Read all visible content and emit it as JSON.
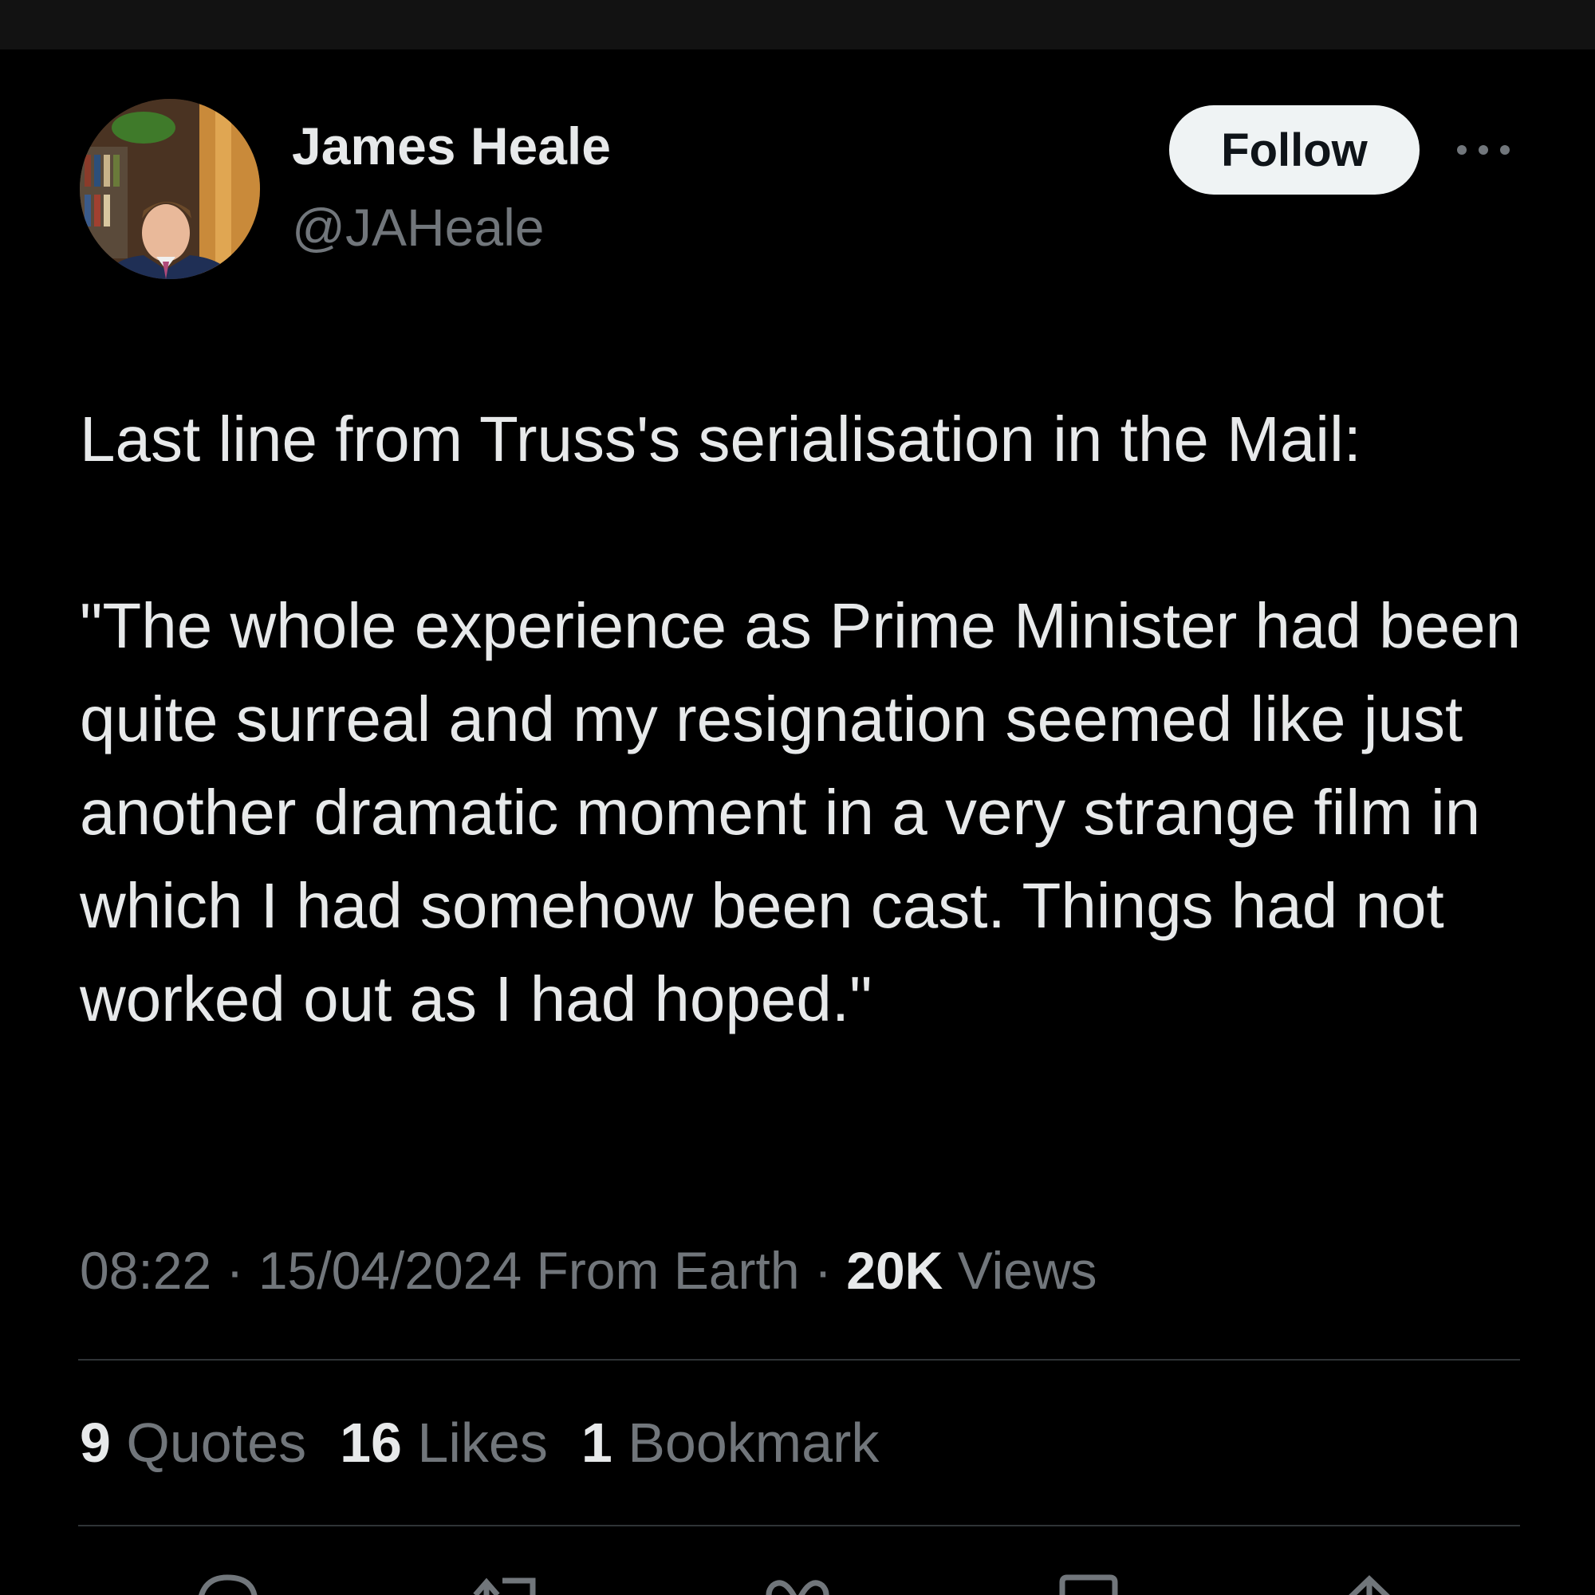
{
  "author": {
    "display_name": "James Heale",
    "handle": "@JAHeale",
    "avatar_icon": "profile-photo"
  },
  "header": {
    "follow_label": "Follow",
    "more_icon": "more-horizontal-icon"
  },
  "tweet": {
    "text": "Last line from Truss's serialisation in the Mail:\n\n\"The whole experience as Prime Minister had been quite surreal and my resignation seemed like just another dramatic moment in a very strange film in which I had somehow been cast. Things had not worked out as I had hoped.\""
  },
  "meta": {
    "time": "08:22",
    "separator": "·",
    "date": "15/04/2024",
    "source": "From Earth",
    "views_count": "20K",
    "views_label": "Views"
  },
  "stats": [
    {
      "count": "9",
      "label": "Quotes"
    },
    {
      "count": "16",
      "label": "Likes"
    },
    {
      "count": "1",
      "label": "Bookmark"
    }
  ],
  "actions": [
    {
      "icon": "reply-icon"
    },
    {
      "icon": "repost-icon"
    },
    {
      "icon": "like-icon"
    },
    {
      "icon": "bookmark-icon"
    },
    {
      "icon": "share-icon"
    }
  ],
  "colors": {
    "background": "#000000",
    "primary_text": "#e7e9ea",
    "secondary_text": "#71767b",
    "divider": "#2f3336",
    "follow_bg": "#eff3f4"
  }
}
